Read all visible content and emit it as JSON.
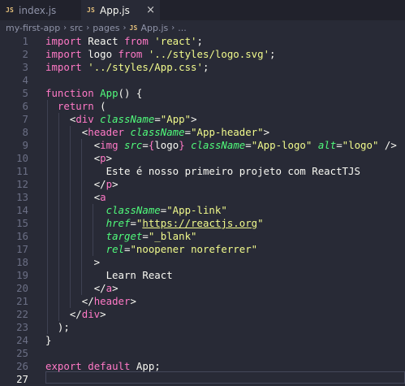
{
  "tabs": [
    {
      "label": "index.js",
      "badge": "JS",
      "active": false
    },
    {
      "label": "App.js",
      "badge": "JS",
      "active": true,
      "close": "×"
    }
  ],
  "breadcrumb": {
    "parts": [
      "my-first-app",
      "src",
      "pages"
    ],
    "file_badge": "JS",
    "file": "App.js",
    "tail": "..."
  },
  "editor": {
    "current_line": 27,
    "lines": [
      {
        "n": "1",
        "tokens": [
          [
            "kw",
            "import"
          ],
          [
            "pl",
            " React "
          ],
          [
            "kw",
            "from"
          ],
          [
            "pl",
            " "
          ],
          [
            "str",
            "'react'"
          ],
          [
            "pl",
            ";"
          ]
        ]
      },
      {
        "n": "2",
        "tokens": [
          [
            "kw",
            "import"
          ],
          [
            "pl",
            " logo "
          ],
          [
            "kw",
            "from"
          ],
          [
            "pl",
            " "
          ],
          [
            "str",
            "'../styles/logo.svg'"
          ],
          [
            "pl",
            ";"
          ]
        ]
      },
      {
        "n": "3",
        "tokens": [
          [
            "kw",
            "import"
          ],
          [
            "pl",
            " "
          ],
          [
            "str",
            "'../styles/App.css'"
          ],
          [
            "pl",
            ";"
          ]
        ]
      },
      {
        "n": "4",
        "tokens": []
      },
      {
        "n": "5",
        "tokens": [
          [
            "kw",
            "function"
          ],
          [
            "pl",
            " "
          ],
          [
            "fn",
            "App"
          ],
          [
            "pl",
            "() {"
          ]
        ]
      },
      {
        "n": "6",
        "tokens": [
          [
            "pl",
            "  "
          ],
          [
            "kw",
            "return"
          ],
          [
            "pl",
            " ("
          ]
        ]
      },
      {
        "n": "7",
        "tokens": [
          [
            "pl",
            "    "
          ],
          [
            "pl",
            "<"
          ],
          [
            "tag",
            "div"
          ],
          [
            "pl",
            " "
          ],
          [
            "attr",
            "className"
          ],
          [
            "pl",
            "="
          ],
          [
            "str",
            "\"App\""
          ],
          [
            "pl",
            ">"
          ]
        ]
      },
      {
        "n": "8",
        "tokens": [
          [
            "pl",
            "      "
          ],
          [
            "pl",
            "<"
          ],
          [
            "tag",
            "header"
          ],
          [
            "pl",
            " "
          ],
          [
            "attr",
            "className"
          ],
          [
            "pl",
            "="
          ],
          [
            "str",
            "\"App-header\""
          ],
          [
            "pl",
            ">"
          ]
        ]
      },
      {
        "n": "9",
        "tokens": [
          [
            "pl",
            "        "
          ],
          [
            "pl",
            "<"
          ],
          [
            "tag",
            "img"
          ],
          [
            "pl",
            " "
          ],
          [
            "attr",
            "src"
          ],
          [
            "pl",
            "="
          ],
          [
            "kw",
            "{"
          ],
          [
            "pl",
            "logo"
          ],
          [
            "kw",
            "}"
          ],
          [
            "pl",
            " "
          ],
          [
            "attr",
            "className"
          ],
          [
            "pl",
            "="
          ],
          [
            "str",
            "\"App-logo\""
          ],
          [
            "pl",
            " "
          ],
          [
            "attr",
            "alt"
          ],
          [
            "pl",
            "="
          ],
          [
            "str",
            "\"logo\""
          ],
          [
            "pl",
            " />"
          ]
        ]
      },
      {
        "n": "10",
        "tokens": [
          [
            "pl",
            "        "
          ],
          [
            "pl",
            "<"
          ],
          [
            "tag",
            "p"
          ],
          [
            "pl",
            ">"
          ]
        ]
      },
      {
        "n": "11",
        "tokens": [
          [
            "pl",
            "          Este é nosso primeiro projeto com ReactTJS"
          ]
        ]
      },
      {
        "n": "12",
        "tokens": [
          [
            "pl",
            "        "
          ],
          [
            "pl",
            "</"
          ],
          [
            "tag",
            "p"
          ],
          [
            "pl",
            ">"
          ]
        ]
      },
      {
        "n": "13",
        "tokens": [
          [
            "pl",
            "        "
          ],
          [
            "pl",
            "<"
          ],
          [
            "tag",
            "a"
          ]
        ]
      },
      {
        "n": "14",
        "tokens": [
          [
            "pl",
            "          "
          ],
          [
            "attr",
            "className"
          ],
          [
            "pl",
            "="
          ],
          [
            "str",
            "\"App-link\""
          ]
        ]
      },
      {
        "n": "15",
        "tokens": [
          [
            "pl",
            "          "
          ],
          [
            "attr",
            "href"
          ],
          [
            "pl",
            "="
          ],
          [
            "str",
            "\""
          ],
          [
            "stru",
            "https://reactjs.org"
          ],
          [
            "str",
            "\""
          ]
        ]
      },
      {
        "n": "16",
        "tokens": [
          [
            "pl",
            "          "
          ],
          [
            "attr",
            "target"
          ],
          [
            "pl",
            "="
          ],
          [
            "str",
            "\"_blank\""
          ]
        ]
      },
      {
        "n": "17",
        "tokens": [
          [
            "pl",
            "          "
          ],
          [
            "attr",
            "rel"
          ],
          [
            "pl",
            "="
          ],
          [
            "str",
            "\"noopener noreferrer\""
          ]
        ]
      },
      {
        "n": "18",
        "tokens": [
          [
            "pl",
            "        >"
          ]
        ]
      },
      {
        "n": "19",
        "tokens": [
          [
            "pl",
            "          Learn React"
          ]
        ]
      },
      {
        "n": "20",
        "tokens": [
          [
            "pl",
            "        "
          ],
          [
            "pl",
            "</"
          ],
          [
            "tag",
            "a"
          ],
          [
            "pl",
            ">"
          ]
        ]
      },
      {
        "n": "21",
        "tokens": [
          [
            "pl",
            "      "
          ],
          [
            "pl",
            "</"
          ],
          [
            "tag",
            "header"
          ],
          [
            "pl",
            ">"
          ]
        ]
      },
      {
        "n": "22",
        "tokens": [
          [
            "pl",
            "    "
          ],
          [
            "pl",
            "</"
          ],
          [
            "tag",
            "div"
          ],
          [
            "pl",
            ">"
          ]
        ]
      },
      {
        "n": "23",
        "tokens": [
          [
            "pl",
            "  );"
          ]
        ]
      },
      {
        "n": "24",
        "tokens": [
          [
            "pl",
            "}"
          ]
        ]
      },
      {
        "n": "25",
        "tokens": []
      },
      {
        "n": "26",
        "tokens": [
          [
            "kw",
            "export"
          ],
          [
            "pl",
            " "
          ],
          [
            "kw",
            "default"
          ],
          [
            "pl",
            " App;"
          ]
        ]
      },
      {
        "n": "27",
        "tokens": []
      }
    ]
  },
  "colors": {
    "background": "#282a36",
    "keyword": "#ff79c6",
    "string": "#f1fa8c",
    "function": "#50fa7b",
    "text": "#f8f8f2",
    "js_badge": "#e5c07b"
  }
}
